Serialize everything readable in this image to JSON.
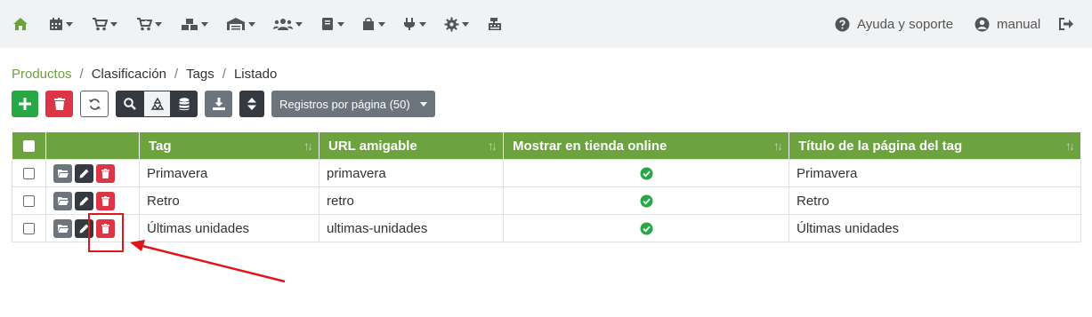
{
  "nav": {
    "icons": [
      "home-icon",
      "calendar-icon",
      "cart-icon",
      "cart-plus-icon",
      "warehouse-icon",
      "store-icon",
      "users-icon",
      "book-icon",
      "bag-icon",
      "plug-icon",
      "gear-icon",
      "cash-register-icon"
    ],
    "help_label": "Ayuda y soporte",
    "user_label": "manual"
  },
  "breadcrumb": {
    "items": [
      "Productos",
      "Clasificación",
      "Tags",
      "Listado"
    ],
    "separator": "/"
  },
  "toolbar": {
    "registros_label": "Registros por página (50)"
  },
  "table": {
    "headers": [
      "Tag",
      "URL amigable",
      "Mostrar en tienda online",
      "Título de la página del tag"
    ],
    "rows": [
      {
        "tag": "Primavera",
        "url": "primavera",
        "title": "Primavera"
      },
      {
        "tag": "Retro",
        "url": "retro",
        "title": "Retro"
      },
      {
        "tag": "Últimas unidades",
        "url": "ultimas-unidades",
        "title": "Últimas unidades"
      }
    ]
  },
  "colors": {
    "accent": "#6ca33f",
    "success": "#28a745",
    "danger": "#dc3545",
    "dark": "#343a40",
    "secondary": "#6c757d",
    "annotation": "#e0161b"
  }
}
